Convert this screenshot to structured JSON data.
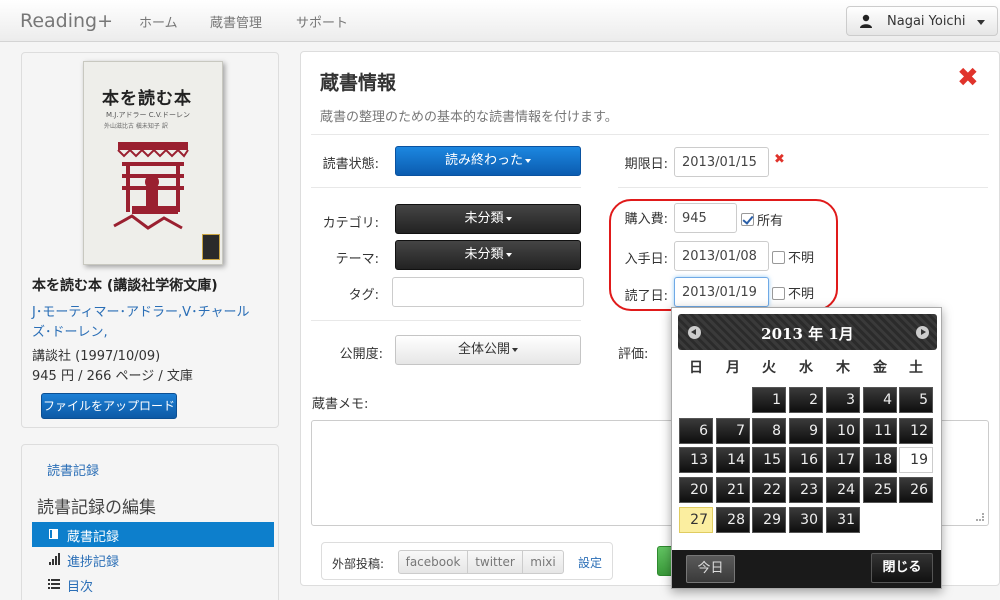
{
  "navbar": {
    "brand": "Reading+",
    "items": [
      "ホーム",
      "蔵書管理",
      "サポート"
    ],
    "user_name": "Nagai Yoichi"
  },
  "book": {
    "cover_title": "本を読む本",
    "cover_author": "M.J.アドラー C.V.ドーレン",
    "cover_translator": "外山滋比古 槇未知子 訳",
    "title": "本を読む本 (講談社学術文庫)",
    "author": "J･モーティマー･アドラー,V･チャールズ･ドーレン,",
    "publisher": "講談社 (1997/10/09)",
    "price_pages": "945 円 / 266 ページ / 文庫",
    "upload_label": "ファイルをアップロード"
  },
  "left_nav": {
    "top_link": "読書記録",
    "heading": "読書記録の編集",
    "items": [
      {
        "label": "蔵書記録",
        "icon": "book-icon",
        "active": true
      },
      {
        "label": "進捗記録",
        "icon": "signal-bars-icon",
        "active": false
      },
      {
        "label": "目次",
        "icon": "list-icon",
        "active": false
      }
    ]
  },
  "form": {
    "title": "蔵書情報",
    "description": "蔵書の整理のための基本的な読書情報を付けます。",
    "status_label": "読書状態:",
    "status_value": "読み終わった",
    "due_label": "期限日:",
    "due_value": "2013/01/15",
    "category_label": "カテゴリ:",
    "category_value": "未分類",
    "theme_label": "テーマ:",
    "theme_value": "未分類",
    "tag_label": "タグ:",
    "tag_value": "",
    "visibility_label": "公開度:",
    "visibility_value": "全体公開",
    "rating_label": "評価:",
    "cost_label": "購入費:",
    "cost_value": "945",
    "owned_label": "所有",
    "owned_checked": true,
    "acquired_label": "入手日:",
    "acquired_value": "2013/01/08",
    "acquired_unknown_label": "不明",
    "finished_label": "読了日:",
    "finished_value": "2013/01/19",
    "finished_unknown_label": "不明",
    "memo_label": "蔵書メモ:",
    "share_label": "外部投稿:",
    "share_options": [
      "facebook",
      "twitter",
      "mixi"
    ],
    "share_settings": "設定",
    "highlight_color": "#e01a1a"
  },
  "datepicker": {
    "title": "2013 年 1月",
    "weekdays": [
      "日",
      "月",
      "火",
      "水",
      "木",
      "金",
      "土"
    ],
    "first_weekday_index": 2,
    "days_in_month": 31,
    "today_day": 19,
    "selected_day": 27,
    "today_button": "今日",
    "close_button": "閉じる"
  }
}
